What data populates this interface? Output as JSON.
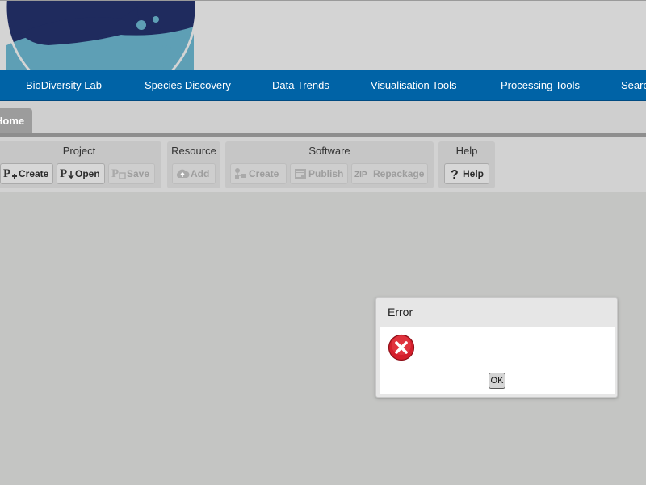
{
  "nav": {
    "items": [
      {
        "label": "BioDiversity Lab"
      },
      {
        "label": "Species Discovery"
      },
      {
        "label": "Data Trends"
      },
      {
        "label": "Visualisation Tools"
      },
      {
        "label": "Processing Tools"
      },
      {
        "label": "Searc"
      }
    ]
  },
  "tabs": {
    "home": "Home"
  },
  "ribbon": {
    "project": {
      "title": "Project",
      "create": "Create",
      "open": "Open",
      "save": "Save"
    },
    "resource": {
      "title": "Resource",
      "add": "Add"
    },
    "software": {
      "title": "Software",
      "create": "Create",
      "publish": "Publish",
      "repackage": "Repackage",
      "zip_badge": "ZIP"
    },
    "help": {
      "title": "Help",
      "help": "Help"
    }
  },
  "dialog": {
    "title": "Error",
    "ok": "OK"
  },
  "colors": {
    "nav": "#0063a6",
    "logo": "#1f2b5e",
    "error": "#d41e2b"
  }
}
